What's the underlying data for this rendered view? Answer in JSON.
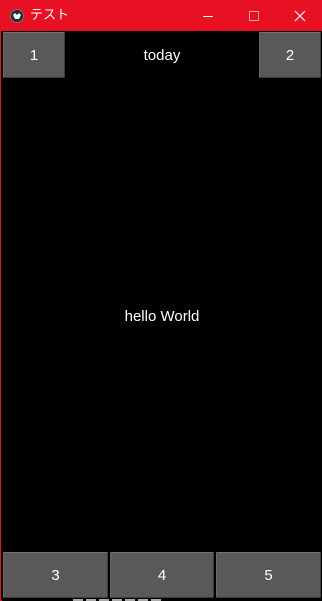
{
  "window": {
    "title": "テスト",
    "accent_color": "#e81123",
    "icons": {
      "app": "app-icon",
      "minimize": "minimize-icon",
      "maximize": "maximize-icon",
      "close": "close-icon"
    }
  },
  "app": {
    "background_color": "#000000",
    "button_color": "#595959",
    "buttons": {
      "top_left": "1",
      "top_right": "2",
      "bottom": [
        "3",
        "4",
        "5"
      ]
    },
    "header_label": "today",
    "center_label": "hello World"
  }
}
